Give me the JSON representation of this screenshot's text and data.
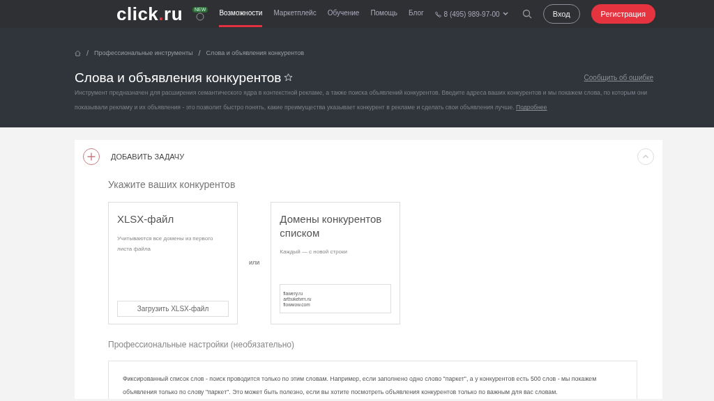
{
  "header": {
    "logo": [
      "click",
      ".",
      "ru"
    ],
    "new_badge": "NEW",
    "nav": [
      {
        "label": "Возможности",
        "selected": true
      },
      {
        "label": "Маркетплейс",
        "selected": false
      },
      {
        "label": "Обучение",
        "selected": false
      },
      {
        "label": "Помощь",
        "selected": false
      },
      {
        "label": "Блог",
        "selected": false
      }
    ],
    "phone": "8 (495) 989-97-00",
    "login": "Вход",
    "register": "Регистрация"
  },
  "breadcrumbs": [
    {
      "separator": "/",
      "label": "Профессиональные инструменты"
    },
    {
      "separator": "/",
      "label": "Слова и объявления конкурентов"
    }
  ],
  "page": {
    "title": "Слова и объявления конкурентов",
    "report_link": "Сообщить об ошибке",
    "description": "Инструмент предназначен для расширения семантического ядра в контекстной рекламе, а также поиска объявлений конкурентов. Введите адреса ваших конкурентов и мы покажем слова, по которым они показывали рекламу и их объявления - это позволит быстро понять, какие преимущества указывает конкурент в рекламе и сделать свои объявления лучше.",
    "more_link": "Подробнее"
  },
  "task": {
    "title": "ДОБАВИТЬ ЗАДАЧУ",
    "expanded": true,
    "subtitle": "Укажите ваших конкурентов",
    "cards": [
      {
        "kind": "file",
        "title": "XLSX-файл",
        "hint": "Учитываются все домены из первого листа файла",
        "button": "Загрузить XLSX-файл"
      },
      {
        "kind": "list",
        "title": "Домены конкурентов списком",
        "hint": "Каждый — с новой строки",
        "value": "\nflawery.ru\nartbuketvrn.ru\nflowwow.com"
      }
    ],
    "or": "или",
    "pro_title": "Профессиональные настройки (необязательно)",
    "pro_text": "Фиксированный список слов - поиск проводится только по этим словам. Например, если заполнено одно слово \"паркет\", а у конкурентов есть 500 слов - мы покажем объявления только по слову \"паркет\". Это может быть полезно, если вы хотите посмотреть объявления конкурентов только по важным для вас словам."
  }
}
